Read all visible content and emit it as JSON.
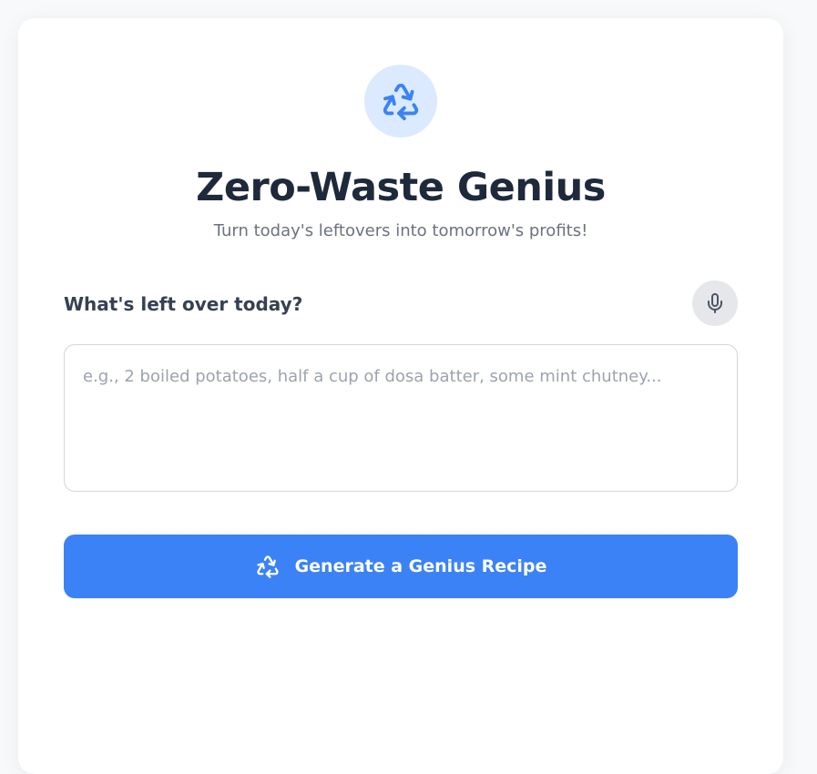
{
  "app": {
    "title": "Zero-Waste Genius",
    "subtitle": "Turn today's leftovers into tomorrow's profits!"
  },
  "form": {
    "label": "What's left over today?",
    "placeholder": "e.g., 2 boiled potatoes, half a cup of dosa batter, some mint chutney...",
    "value": "",
    "submit_label": "Generate a Genius Recipe"
  },
  "icons": {
    "logo": "recycle-icon",
    "mic": "microphone-icon",
    "button": "recycle-icon"
  },
  "colors": {
    "accent": "#3b82f6",
    "accent_light": "#dbeafe",
    "title": "#1e293b",
    "muted": "#6b7280",
    "background": "#f8f9fb"
  }
}
